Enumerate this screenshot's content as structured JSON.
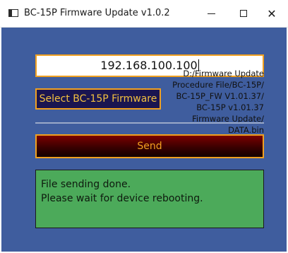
{
  "window": {
    "title": "BC-15P Firmware Update v1.0.2",
    "controls": {
      "minimize_icon": "minimize-icon",
      "maximize_icon": "maximize-icon",
      "close_icon": "close-icon",
      "close_glyph": "✕"
    }
  },
  "form": {
    "ip_address": "192.168.100.100",
    "file_path": "D:/Firmware Update\nProcedure File/BC-15P/\nBC-15P_FW V1.01.37/\nBC-15P v1.01.37\nFirmware Update/\nDATA.bin",
    "select_label": "Select BC-15P Firmware",
    "send_label": "Send"
  },
  "status": {
    "line1": "File sending done.",
    "line2": "Please wait for device rebooting."
  },
  "colors": {
    "background": "#3f5d9e",
    "accent_border": "#f0a020",
    "select_bg": "#1a1550",
    "send_bg": "#5a0000",
    "status_bg": "#4caa5a"
  }
}
